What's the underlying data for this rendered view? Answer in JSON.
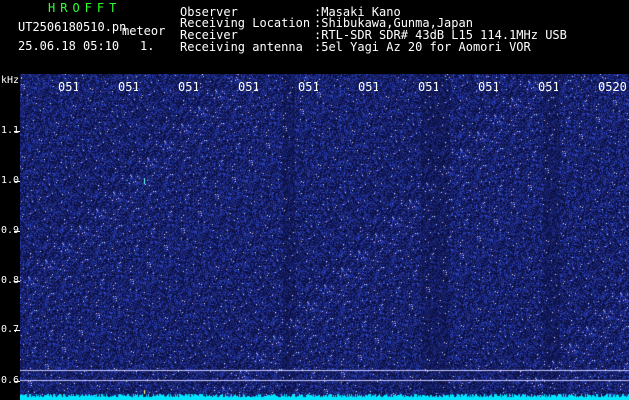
{
  "header": {
    "app_title": "HROFFT",
    "file_name": "UT2506180510.pn",
    "meteor_label": "meteor",
    "date_time": "25.06.18 05:10",
    "count": "1."
  },
  "info": {
    "observer_label": "Observer",
    "observer_value": ":Masaki Kano",
    "location_label": "Receiving Location",
    "location_value": ":Shibukawa,Gunma,Japan",
    "receiver_label": "Receiver",
    "receiver_value": ":RTL-SDR SDR# 43dB L15 114.1MHz USB",
    "antenna_label": "Receiving antenna",
    "antenna_value": ":5el Yagi Az 20 for Aomori VOR"
  },
  "axis": {
    "unit": "kHz",
    "y_labels": [
      "1.1",
      "1.0",
      "0.9",
      "0.8",
      "0.7",
      "0.6"
    ],
    "time_labels": [
      "051",
      "051",
      "051",
      "051",
      "051",
      "051",
      "051",
      "051",
      "051",
      "0520"
    ]
  },
  "colors": {
    "background": "#000000",
    "title_green": "#33ff33",
    "noise_base": "#1a1f8c",
    "baseline_cyan": "#00e5ff",
    "ref_line": "#c8c8ff"
  }
}
